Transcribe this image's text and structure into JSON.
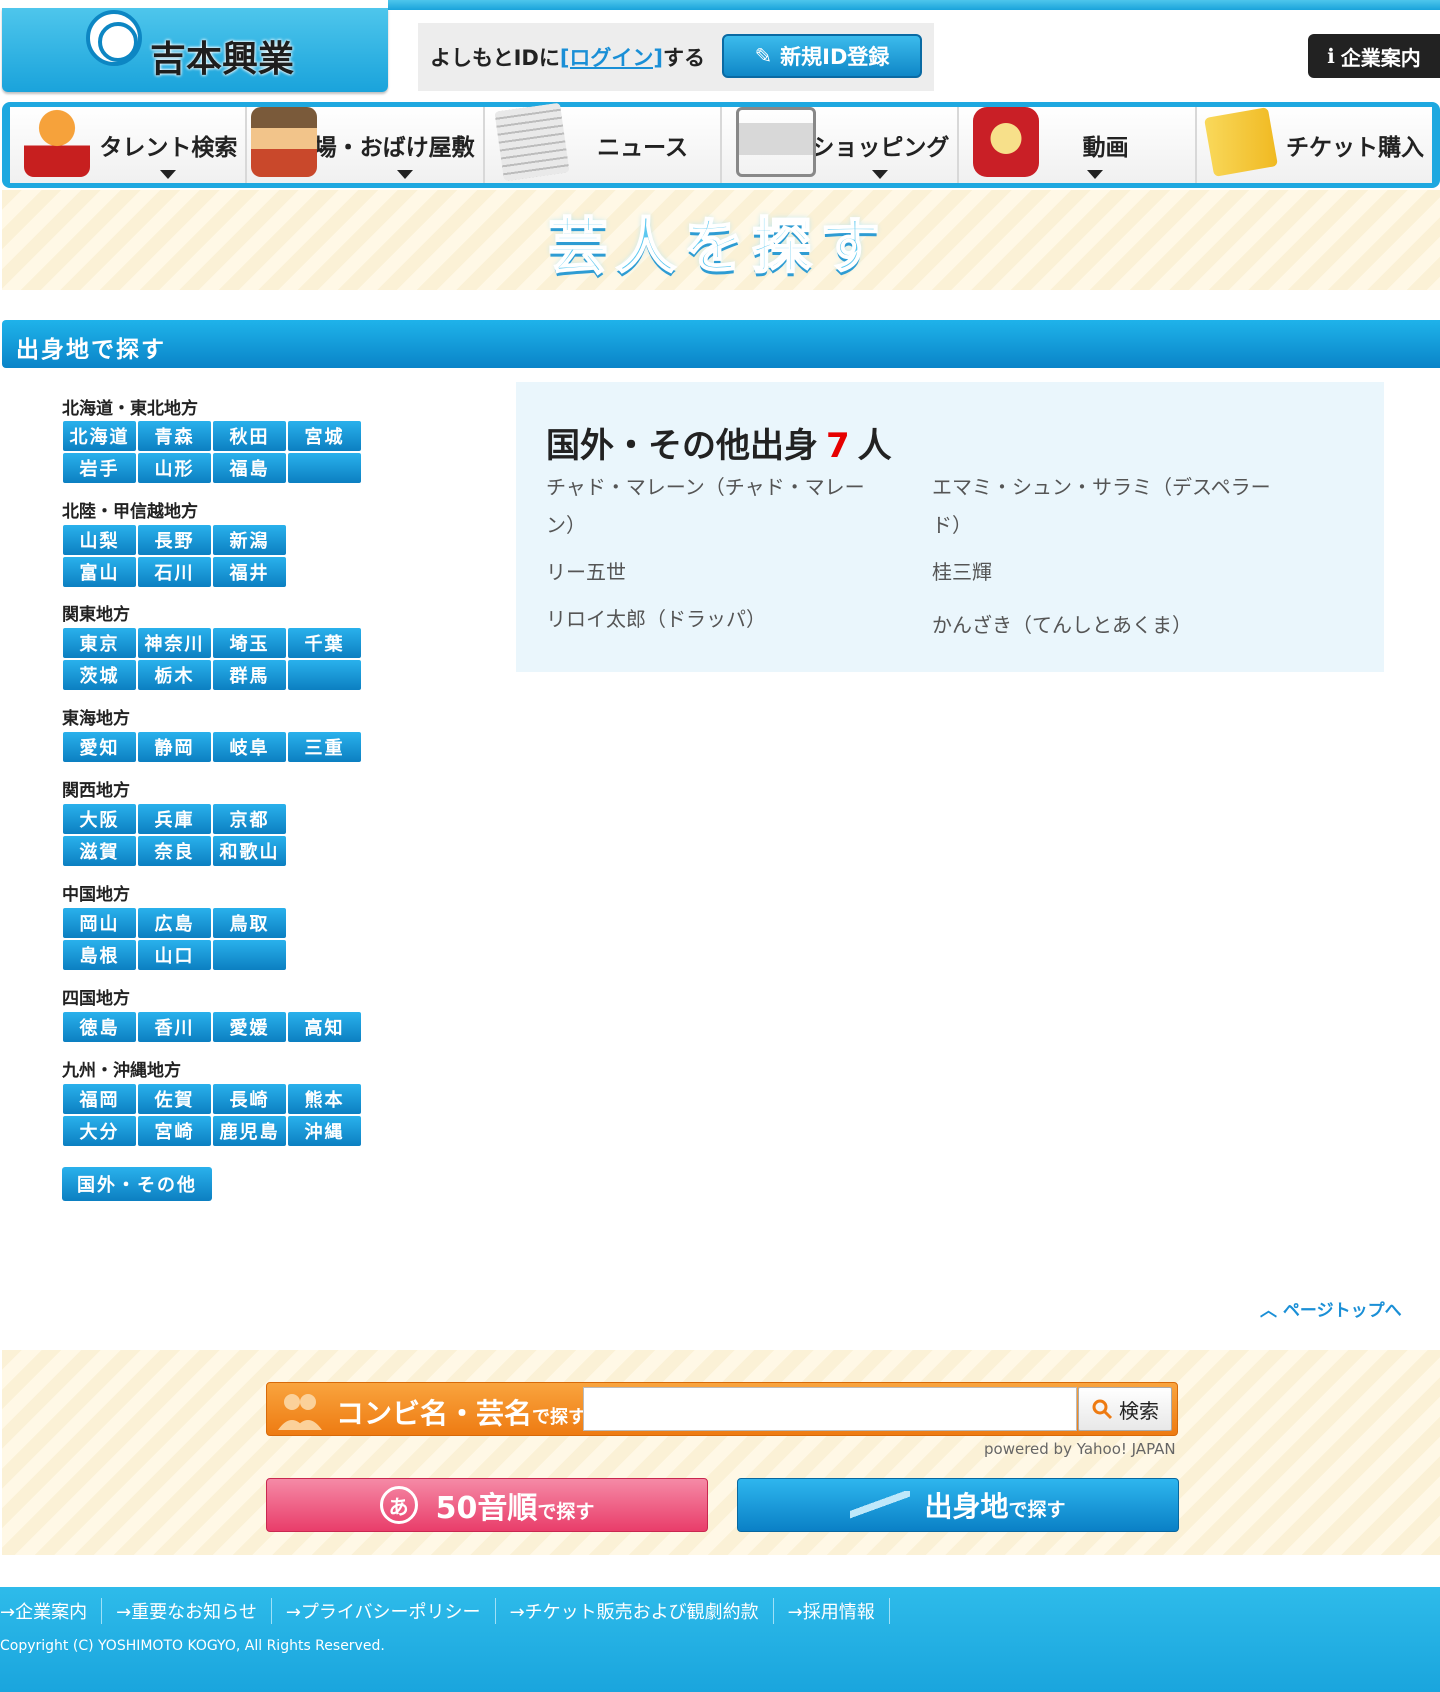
{
  "header": {
    "logo_text": "吉本興業",
    "login_prefix": "よしもとIDに",
    "login_link": "[ログイン]",
    "login_suffix": "する",
    "signup_label": "新規ID登録",
    "corp_label": "企業案内"
  },
  "nav": [
    {
      "label": "タレント検索",
      "icon": "talent-icon",
      "caret": true
    },
    {
      "label": "劇場・おばけ屋敷",
      "icon": "theater-icon",
      "caret": true
    },
    {
      "label": "ニュース",
      "icon": "news-icon",
      "caret": false
    },
    {
      "label": "ショッピング",
      "icon": "cart-icon",
      "caret": true
    },
    {
      "label": "動画",
      "icon": "tv-icon",
      "caret": true
    },
    {
      "label": "チケット購入",
      "icon": "ticket-icon",
      "caret": false
    }
  ],
  "banner_title": "芸人を探す",
  "section_title": "出身地で探す",
  "regions": [
    {
      "name": "北海道・東北地方",
      "prefs": [
        "北海道",
        "青森",
        "秋田",
        "宮城",
        "岩手",
        "山形",
        "福島",
        ""
      ]
    },
    {
      "name": "北陸・甲信越地方",
      "prefs": [
        "山梨",
        "長野",
        "新潟",
        "富山",
        "石川",
        "福井"
      ]
    },
    {
      "name": "関東地方",
      "prefs": [
        "東京",
        "神奈川",
        "埼玉",
        "千葉",
        "茨城",
        "栃木",
        "群馬",
        ""
      ]
    },
    {
      "name": "東海地方",
      "prefs": [
        "愛知",
        "静岡",
        "岐阜",
        "三重"
      ]
    },
    {
      "name": "関西地方",
      "prefs": [
        "大阪",
        "兵庫",
        "京都",
        "滋賀",
        "奈良",
        "和歌山"
      ]
    },
    {
      "name": "中国地方",
      "prefs": [
        "岡山",
        "広島",
        "鳥取",
        "島根",
        "山口",
        ""
      ]
    },
    {
      "name": "四国地方",
      "prefs": [
        "徳島",
        "香川",
        "愛媛",
        "高知"
      ]
    },
    {
      "name": "九州・沖縄地方",
      "prefs": [
        "福岡",
        "佐賀",
        "長崎",
        "熊本",
        "大分",
        "宮崎",
        "鹿児島",
        "沖縄"
      ]
    }
  ],
  "kokugai_label": "国外・その他",
  "result": {
    "title_prefix": "国外・その他出身",
    "count": "7",
    "title_suffix": "人",
    "people": [
      "チャド・マレーン（チャド・マレーン）",
      "エマミ・シュン・サラミ（デスペラード）",
      "リー五世",
      "桂三輝",
      "リロイ太郎（ドラッパ）",
      "かんざき（てんしとあくま）"
    ]
  },
  "page_top_label": "ページトップへ",
  "search": {
    "label": "コンビ名・芸名",
    "label_small": "で探す",
    "placeholder": "",
    "button_label": "検索",
    "powered": "powered by Yahoo! JAPAN"
  },
  "btn_50": {
    "circle": "あ",
    "label": "50音順",
    "small": "で探す"
  },
  "btn_area": {
    "label": "出身地",
    "small": "で探す"
  },
  "footer": {
    "links": [
      "→企業案内",
      "→重要なお知らせ",
      "→プライバシーポリシー",
      "→チケット販売および観劇約款",
      "→採用情報"
    ],
    "copyright": "Copyright (C) YOSHIMOTO KOGYO, All Rights Reserved."
  },
  "colors": {
    "accent_blue": "#1aa3db",
    "count_red": "#e60000",
    "search_orange": "#ee7b12",
    "pink": "#e93d6a"
  }
}
